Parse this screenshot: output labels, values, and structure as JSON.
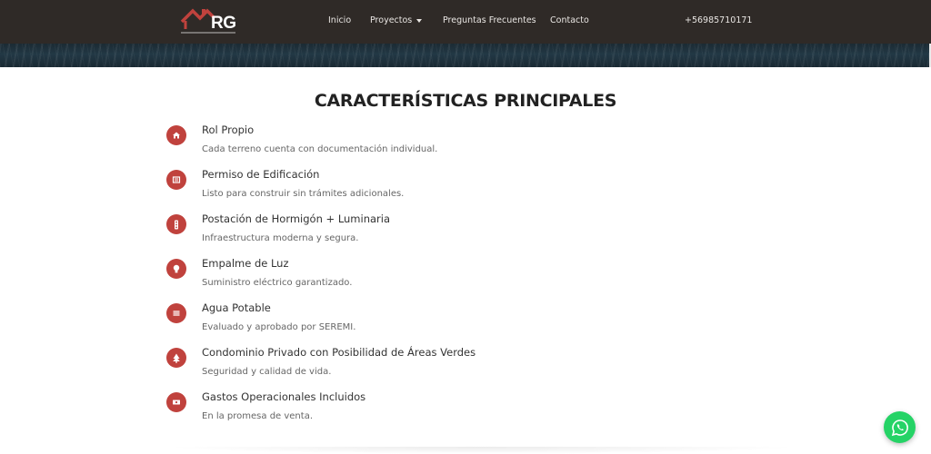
{
  "header": {
    "logo_text": "RG",
    "nav": [
      {
        "label": "Inicio"
      },
      {
        "label": "Proyectos",
        "has_dropdown": true
      },
      {
        "label": "Preguntas Frecuentes"
      },
      {
        "label": "Contacto"
      }
    ],
    "phone": "+56985710171"
  },
  "colors": {
    "header_bg": "#2f2a27",
    "accent": "#c0423d",
    "whatsapp": "#25d366"
  },
  "section": {
    "title": "CARACTERÍSTICAS PRINCIPALES",
    "features": [
      {
        "icon": "home-icon",
        "title": "Rol Propio",
        "description": "Cada terreno cuenta con documentación individual."
      },
      {
        "icon": "document-icon",
        "title": "Permiso de Edificación",
        "description": "Listo para construir sin trámites adicionales."
      },
      {
        "icon": "traffic-light-icon",
        "title": "Postación de Hormigón + Luminaria",
        "description": "Infraestructura moderna y segura."
      },
      {
        "icon": "lightbulb-icon",
        "title": "Empalme de Luz",
        "description": "Suministro eléctrico garantizado."
      },
      {
        "icon": "water-lines-icon",
        "title": "Agua Potable",
        "description": "Evaluado y aprobado por SEREMI."
      },
      {
        "icon": "tree-icon",
        "title": "Condominio Privado con Posibilidad de Áreas Verdes",
        "description": "Seguridad y calidad de vida."
      },
      {
        "icon": "money-icon",
        "title": "Gastos Operacionales Incluidos",
        "description": "En la promesa de venta."
      }
    ]
  },
  "floating": {
    "whatsapp_icon": "whatsapp-icon"
  }
}
